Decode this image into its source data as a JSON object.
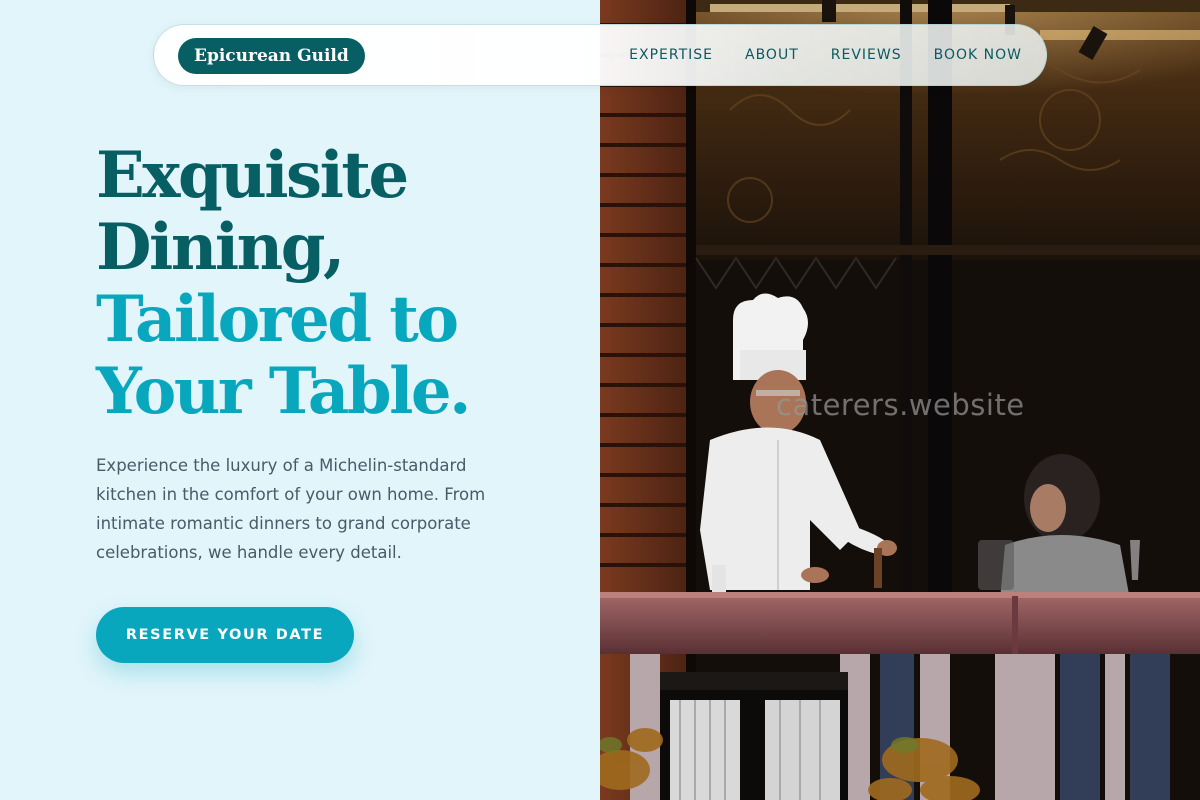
{
  "brand": {
    "name": "Epicurean Guild"
  },
  "nav": {
    "items": [
      {
        "label": "EXPERTISE"
      },
      {
        "label": "ABOUT"
      },
      {
        "label": "REVIEWS"
      },
      {
        "label": "BOOK NOW"
      }
    ]
  },
  "hero": {
    "title_lines_dark": [
      "Exquisite",
      "Dining,"
    ],
    "title_lines_light": [
      "Tailored to",
      "Your Table."
    ],
    "description": "Experience the luxury of a Michelin-standard kitchen in the comfort of your own home. From intimate romantic dinners to grand corporate celebrations, we handle every detail.",
    "cta_label": "RESERVE YOUR DATE"
  },
  "photo": {
    "watermark": "caterers.website"
  },
  "colors": {
    "page_bg": "#e1f5fb",
    "brand_dark": "#075f63",
    "accent": "#08a7bd",
    "body_text": "#4a5a67",
    "nav_text": "#0b5a62"
  }
}
